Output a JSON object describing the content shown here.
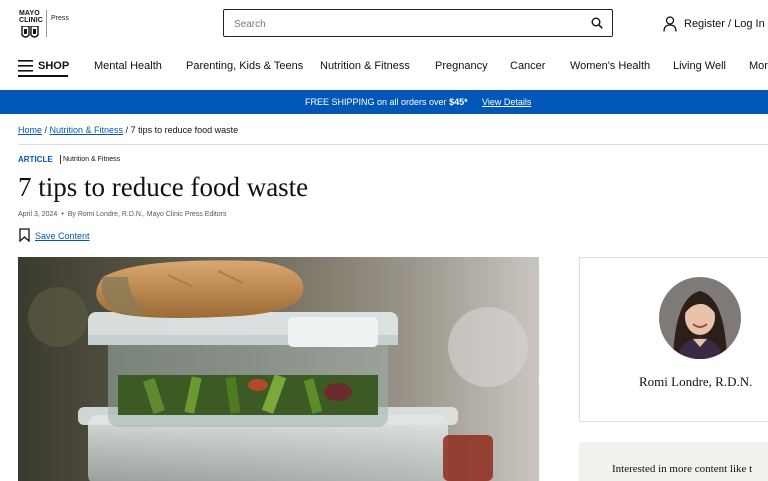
{
  "brand": {
    "logo_line1": "MAYO",
    "logo_line2": "CLINIC",
    "press": "Press"
  },
  "search": {
    "placeholder": "Search"
  },
  "account": {
    "register_label": "Register / Log In"
  },
  "nav": {
    "shop_label": "SHOP",
    "items": [
      {
        "label": "Mental Health"
      },
      {
        "label": "Parenting, Kids & Teens"
      },
      {
        "label": "Nutrition & Fitness"
      },
      {
        "label": "Pregnancy"
      },
      {
        "label": "Cancer"
      },
      {
        "label": "Women's Health"
      },
      {
        "label": "Living Well"
      },
      {
        "label": "Mor"
      }
    ]
  },
  "banner": {
    "prefix": "FREE SHIPPING on all orders over ",
    "amount": "$45*",
    "link_label": "View Details"
  },
  "breadcrumb": {
    "home": "Home",
    "sep1": " / ",
    "category": "Nutrition & Fitness",
    "sep2": " / ",
    "current": "7 tips to reduce food waste"
  },
  "article": {
    "type": "ARTICLE",
    "category": "Nutrition & Fitness",
    "title": "7 tips to reduce food waste",
    "date": "April 3, 2024",
    "dot": "•",
    "byline": "By Romi Londre, R.D.N., Mayo Clinic Press Editors",
    "save_label": "Save Content"
  },
  "author": {
    "name": "Romi Londre, R.D.N."
  },
  "interest": {
    "text": "Interested in more content like t"
  },
  "colors": {
    "accent": "#0057b8",
    "banner_bg": "#0057b8",
    "interest_bg": "#f3f1ee"
  },
  "icons": {
    "search": "search-icon",
    "user": "user-icon",
    "menu": "hamburger-icon",
    "bookmark": "bookmark-icon"
  }
}
